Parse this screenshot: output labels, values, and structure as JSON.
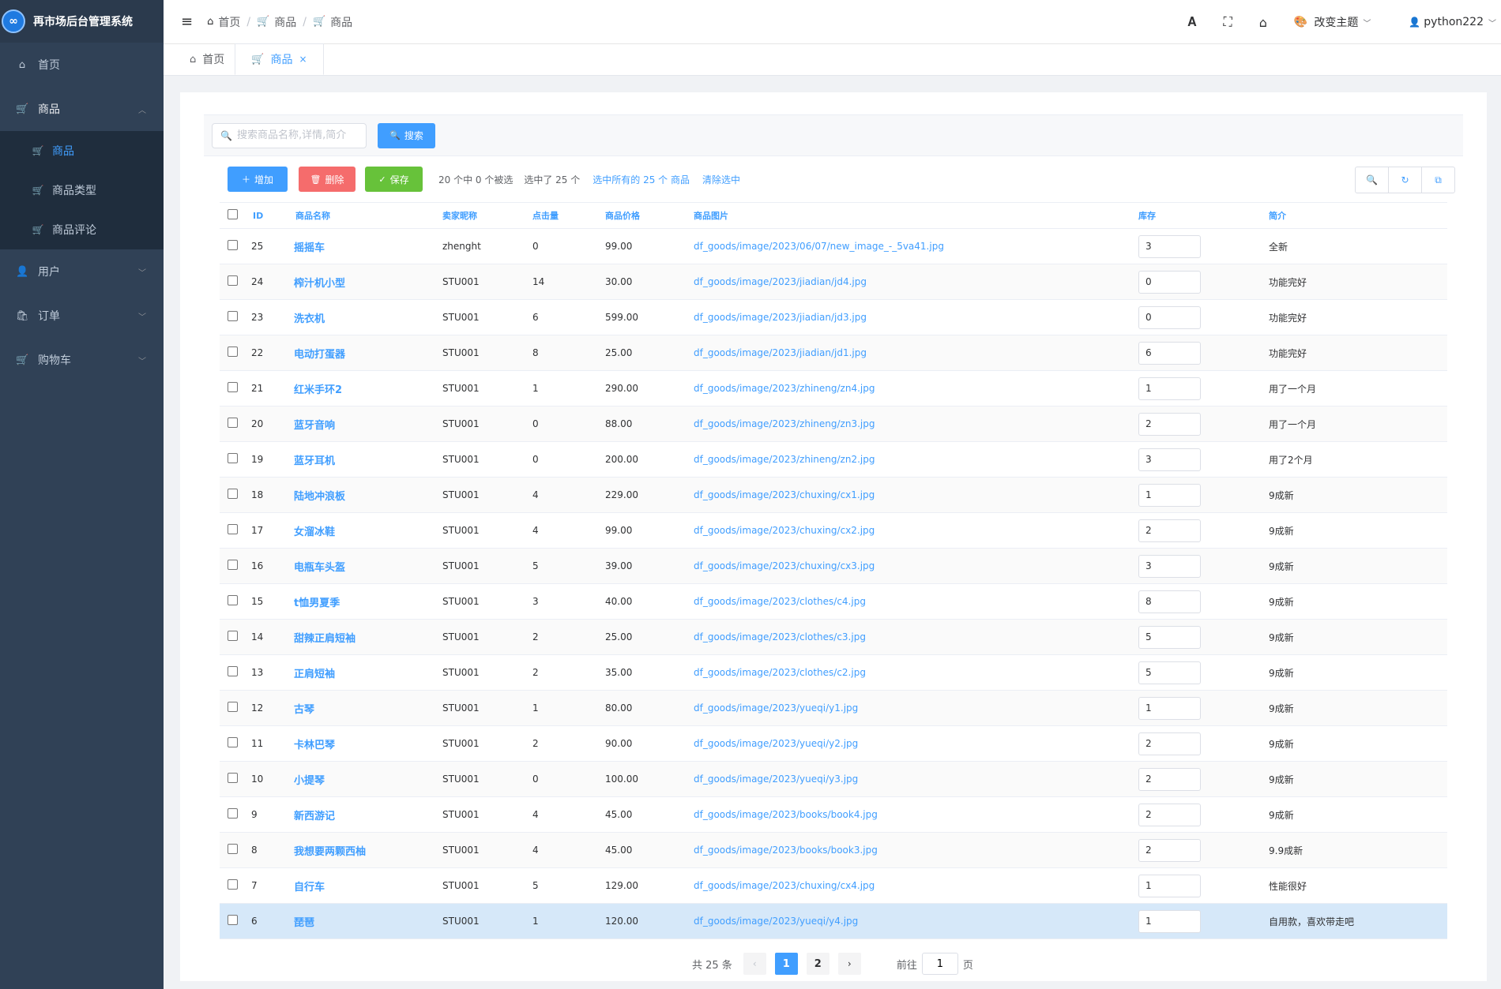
{
  "app": {
    "title": "再市场后台管理系统",
    "logo_glyph": "∞",
    "brand_color": "#409eff"
  },
  "sidebar": {
    "home": "首页",
    "goods": "商品",
    "goods_sub": [
      "商品",
      "商品类型",
      "商品评论"
    ],
    "users": "用户",
    "orders": "订单",
    "cart": "购物车"
  },
  "header": {
    "breadcrumb": [
      "首页",
      "商品",
      "商品"
    ],
    "theme_label": "改变主题",
    "username": "python222"
  },
  "tags": {
    "home": "首页",
    "goods": "商品"
  },
  "search": {
    "placeholder": "搜索商品名称,详情,简介",
    "button": "搜索"
  },
  "toolbar": {
    "add": "增加",
    "delete": "删除",
    "save": "保存",
    "selected_info": "20 个中 0 个被选",
    "selected_count": "选中了 25 个",
    "select_all": "选中所有的 25 个 商品",
    "clear": "清除选中"
  },
  "table": {
    "columns": [
      "ID",
      "商品名称",
      "卖家昵称",
      "点击量",
      "商品价格",
      "商品图片",
      "库存",
      "简介"
    ],
    "rows": [
      {
        "id": "25",
        "name": "摇摇车",
        "seller": "zhenght",
        "clicks": "0",
        "price": "99.00",
        "image": "df_goods/image/2023/06/07/new_image_-_5va41.jpg",
        "stock": "3",
        "desc": "全新"
      },
      {
        "id": "24",
        "name": "榨汁机小型",
        "seller": "STU001",
        "clicks": "14",
        "price": "30.00",
        "image": "df_goods/image/2023/jiadian/jd4.jpg",
        "stock": "0",
        "desc": "功能完好"
      },
      {
        "id": "23",
        "name": "洗衣机",
        "seller": "STU001",
        "clicks": "6",
        "price": "599.00",
        "image": "df_goods/image/2023/jiadian/jd3.jpg",
        "stock": "0",
        "desc": "功能完好"
      },
      {
        "id": "22",
        "name": "电动打蛋器",
        "seller": "STU001",
        "clicks": "8",
        "price": "25.00",
        "image": "df_goods/image/2023/jiadian/jd1.jpg",
        "stock": "6",
        "desc": "功能完好"
      },
      {
        "id": "21",
        "name": "红米手环2",
        "seller": "STU001",
        "clicks": "1",
        "price": "290.00",
        "image": "df_goods/image/2023/zhineng/zn4.jpg",
        "stock": "1",
        "desc": "用了一个月"
      },
      {
        "id": "20",
        "name": "蓝牙音响",
        "seller": "STU001",
        "clicks": "0",
        "price": "88.00",
        "image": "df_goods/image/2023/zhineng/zn3.jpg",
        "stock": "2",
        "desc": "用了一个月"
      },
      {
        "id": "19",
        "name": "蓝牙耳机",
        "seller": "STU001",
        "clicks": "0",
        "price": "200.00",
        "image": "df_goods/image/2023/zhineng/zn2.jpg",
        "stock": "3",
        "desc": "用了2个月"
      },
      {
        "id": "18",
        "name": "陆地冲浪板",
        "seller": "STU001",
        "clicks": "4",
        "price": "229.00",
        "image": "df_goods/image/2023/chuxing/cx1.jpg",
        "stock": "1",
        "desc": "9成新"
      },
      {
        "id": "17",
        "name": "女溜冰鞋",
        "seller": "STU001",
        "clicks": "4",
        "price": "99.00",
        "image": "df_goods/image/2023/chuxing/cx2.jpg",
        "stock": "2",
        "desc": "9成新"
      },
      {
        "id": "16",
        "name": "电瓶车头盔",
        "seller": "STU001",
        "clicks": "5",
        "price": "39.00",
        "image": "df_goods/image/2023/chuxing/cx3.jpg",
        "stock": "3",
        "desc": "9成新"
      },
      {
        "id": "15",
        "name": "t恤男夏季",
        "seller": "STU001",
        "clicks": "3",
        "price": "40.00",
        "image": "df_goods/image/2023/clothes/c4.jpg",
        "stock": "8",
        "desc": "9成新"
      },
      {
        "id": "14",
        "name": "甜辣正肩短袖",
        "seller": "STU001",
        "clicks": "2",
        "price": "25.00",
        "image": "df_goods/image/2023/clothes/c3.jpg",
        "stock": "5",
        "desc": "9成新"
      },
      {
        "id": "13",
        "name": "正肩短袖",
        "seller": "STU001",
        "clicks": "2",
        "price": "35.00",
        "image": "df_goods/image/2023/clothes/c2.jpg",
        "stock": "5",
        "desc": "9成新"
      },
      {
        "id": "12",
        "name": "古琴",
        "seller": "STU001",
        "clicks": "1",
        "price": "80.00",
        "image": "df_goods/image/2023/yueqi/y1.jpg",
        "stock": "1",
        "desc": "9成新"
      },
      {
        "id": "11",
        "name": "卡林巴琴",
        "seller": "STU001",
        "clicks": "2",
        "price": "90.00",
        "image": "df_goods/image/2023/yueqi/y2.jpg",
        "stock": "2",
        "desc": "9成新"
      },
      {
        "id": "10",
        "name": "小提琴",
        "seller": "STU001",
        "clicks": "0",
        "price": "100.00",
        "image": "df_goods/image/2023/yueqi/y3.jpg",
        "stock": "2",
        "desc": "9成新"
      },
      {
        "id": "9",
        "name": "新西游记",
        "seller": "STU001",
        "clicks": "4",
        "price": "45.00",
        "image": "df_goods/image/2023/books/book4.jpg",
        "stock": "2",
        "desc": "9成新"
      },
      {
        "id": "8",
        "name": "我想要两颗西柚",
        "seller": "STU001",
        "clicks": "4",
        "price": "45.00",
        "image": "df_goods/image/2023/books/book3.jpg",
        "stock": "2",
        "desc": "9.9成新"
      },
      {
        "id": "7",
        "name": "自行车",
        "seller": "STU001",
        "clicks": "5",
        "price": "129.00",
        "image": "df_goods/image/2023/chuxing/cx4.jpg",
        "stock": "1",
        "desc": "性能很好"
      },
      {
        "id": "6",
        "name": "琵琶",
        "seller": "STU001",
        "clicks": "1",
        "price": "120.00",
        "image": "df_goods/image/2023/yueqi/y4.jpg",
        "stock": "1",
        "desc": "自用款，喜欢带走吧"
      }
    ]
  },
  "pagination": {
    "total": "共 25 条",
    "pages": [
      "1",
      "2"
    ],
    "goto_prefix": "前往",
    "goto_value": "1",
    "goto_suffix": "页"
  }
}
